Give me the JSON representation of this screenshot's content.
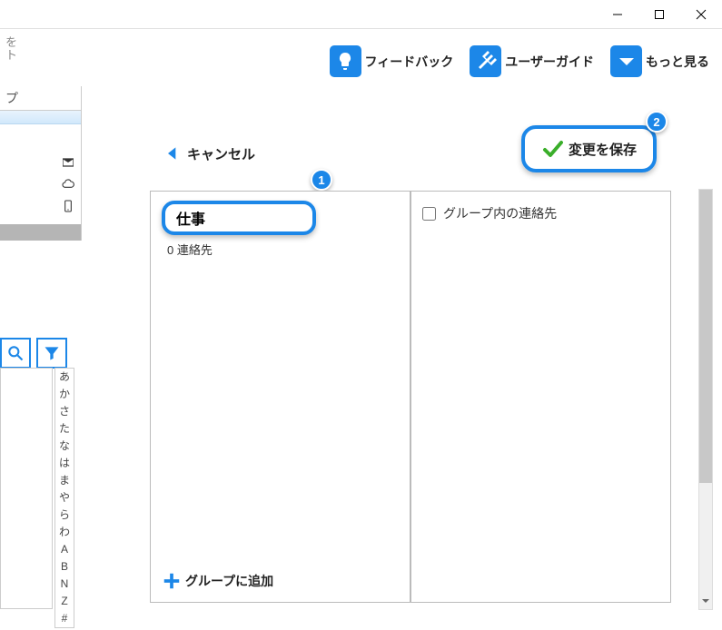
{
  "titlebar": {
    "minimize": "minimize",
    "maximize": "maximize",
    "close": "close"
  },
  "header": {
    "feedback": "フィードバック",
    "user_guide": "ユーザーガイド",
    "more": "もっと見る"
  },
  "left": {
    "truncated1": "を",
    "truncated2": "ト",
    "group_label": "プ",
    "index_chars": [
      "あ",
      "か",
      "さ",
      "た",
      "な",
      "は",
      "ま",
      "や",
      "ら",
      "わ",
      "A",
      "B",
      "N",
      "Z",
      "#"
    ]
  },
  "main": {
    "cancel": "キャンセル",
    "save": "変更を保存",
    "group_name_value": "仕事",
    "contacts_count": "0 連絡先",
    "add_to_group": "グループに追加",
    "checkbox_label": "グループ内の連絡先"
  },
  "badges": {
    "one": "1",
    "two": "2"
  }
}
